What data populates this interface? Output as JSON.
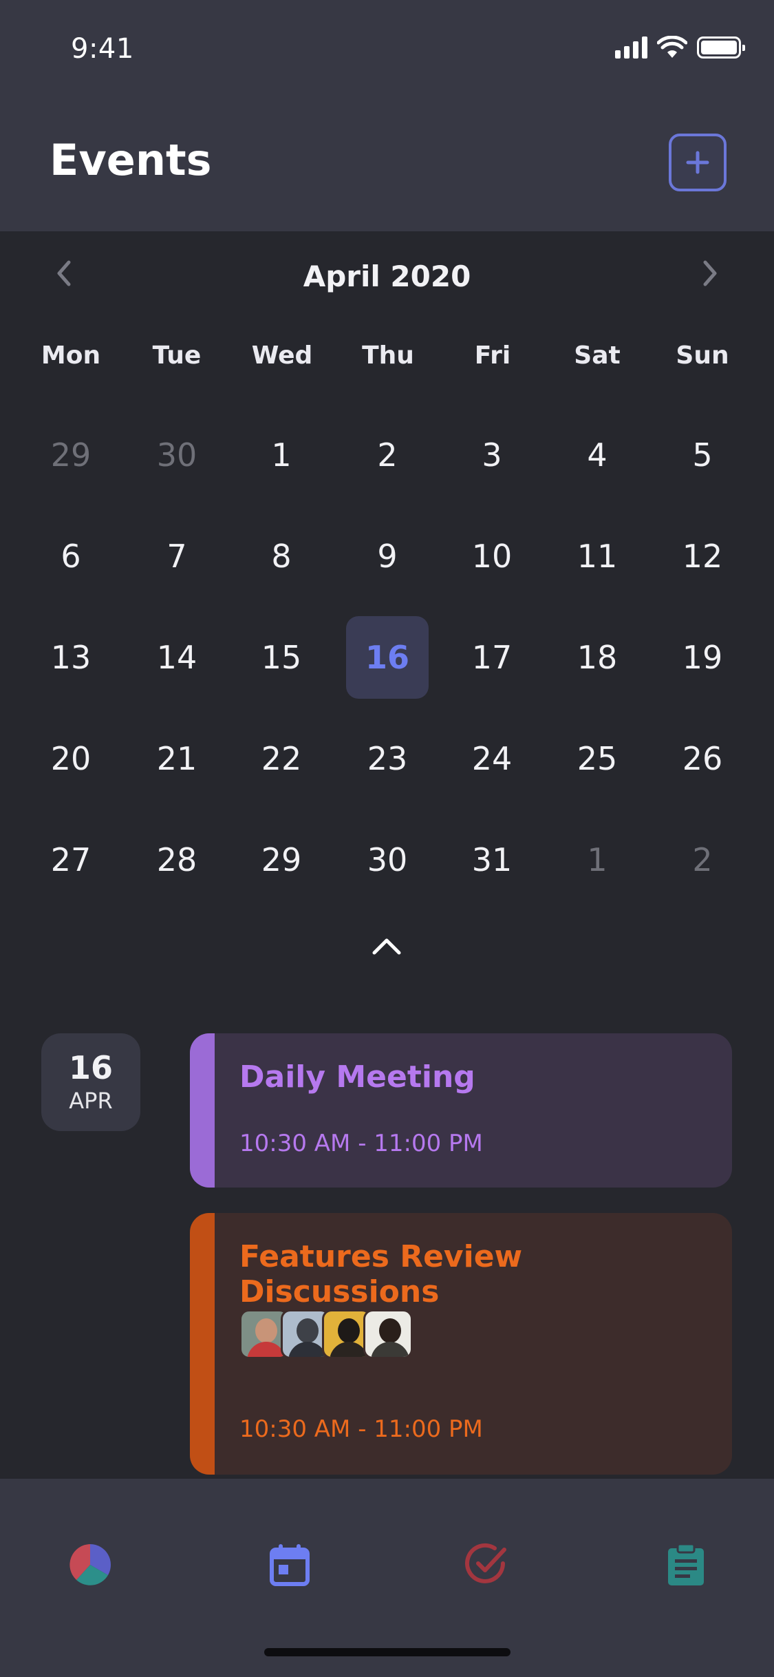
{
  "status_bar": {
    "time": "9:41"
  },
  "header": {
    "title": "Events",
    "add_icon": "plus-icon"
  },
  "calendar": {
    "month_label": "April 2020",
    "weekdays": [
      "Mon",
      "Tue",
      "Wed",
      "Thu",
      "Fri",
      "Sat",
      "Sun"
    ],
    "weeks": [
      [
        "29",
        "30",
        "1",
        "2",
        "3",
        "4",
        "5"
      ],
      [
        "6",
        "7",
        "8",
        "9",
        "10",
        "11",
        "12"
      ],
      [
        "13",
        "14",
        "15",
        "16",
        "17",
        "18",
        "19"
      ],
      [
        "20",
        "21",
        "22",
        "23",
        "24",
        "25",
        "26"
      ],
      [
        "27",
        "28",
        "29",
        "30",
        "31",
        "1",
        "2"
      ]
    ],
    "selected_day": "16",
    "accent_color": "#6d7ef2"
  },
  "agenda": {
    "date_badge": {
      "day": "16",
      "month": "APR"
    },
    "events": [
      {
        "title": "Daily Meeting",
        "time": "10:30 AM - 11:00 PM",
        "color": "#b679ef"
      },
      {
        "title": "Features Review Discussions",
        "time": "10:30 AM - 11:00 PM",
        "color": "#ec6a1d",
        "attendees": [
          "avatar-1",
          "avatar-2",
          "avatar-3",
          "avatar-4"
        ]
      }
    ]
  },
  "tab_bar": {
    "items": [
      {
        "icon": "dashboard-icon",
        "active": false
      },
      {
        "icon": "calendar-icon",
        "active": true
      },
      {
        "icon": "check-circle-icon",
        "active": false
      },
      {
        "icon": "clipboard-icon",
        "active": false
      }
    ]
  }
}
